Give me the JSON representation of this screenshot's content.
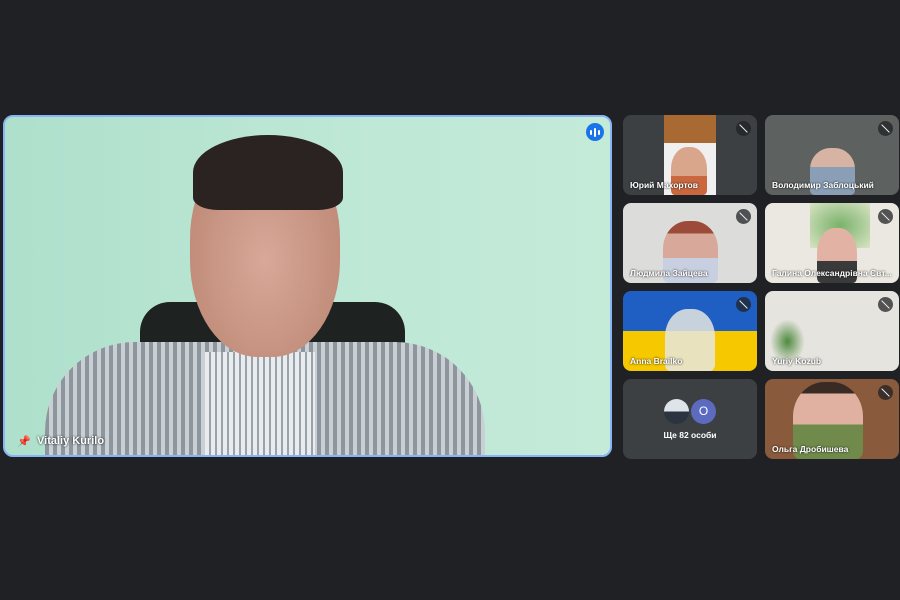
{
  "main_speaker": {
    "name": "Vitaliy Kurilo"
  },
  "participants": [
    {
      "name": "Юрий Махортов",
      "muted": true
    },
    {
      "name": "Володимир Заблоцький",
      "muted": true
    },
    {
      "name": "Людмила Зайцева",
      "muted": true
    },
    {
      "name": "Галина Олександрівна Євт...",
      "muted": true
    },
    {
      "name": "Anna Brailko",
      "muted": true
    },
    {
      "name": "Yuriy Kozub",
      "muted": true
    },
    {
      "name": "Ольга Дробишева",
      "muted": true
    }
  ],
  "overflow": {
    "label": "Ще 82 особи",
    "avatar_initial": "O",
    "avatar_color": "#5c6bc0"
  },
  "colors": {
    "active_border": "#8ab4f8",
    "speaking": "#1a73e8",
    "background": "#202124",
    "tile": "#3c4043"
  }
}
